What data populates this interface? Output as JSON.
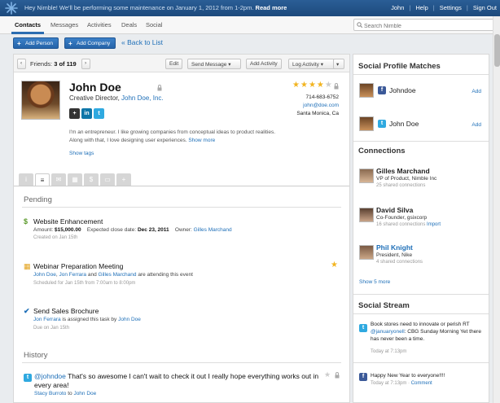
{
  "topbar": {
    "maintenance": "Hey Nimble! We'll be performing some maintenance on January 1, 2012 from 1-2pm.",
    "read_more": "Read more",
    "user": "John",
    "links": [
      "Help",
      "Settings",
      "Sign Out"
    ]
  },
  "nav": {
    "tabs": [
      "Contacts",
      "Messages",
      "Activities",
      "Deals",
      "Social"
    ],
    "active_tab": "Contacts",
    "search_placeholder": "Search Nimble"
  },
  "actions": {
    "add_person": "Add Person",
    "add_company": "Add Company",
    "back": "« Back to List"
  },
  "toolbar": {
    "friends_label": "Friends:",
    "friends_pos": "3 of 119",
    "edit": "Edit",
    "send_message": "Send Message",
    "add_activity": "Add Activity",
    "log_activity": "Log Activity"
  },
  "contact": {
    "name": "John Doe",
    "title": "Creative Director,",
    "company": "John Doe, Inc.",
    "phone": "714-683-6752",
    "email": "john@doe.com",
    "location": "Santa Monica, Ca",
    "rating": 4,
    "rating_max": 5,
    "bio": "I'm an entrepreneur. I like growing companies from conceptual ideas to product realities. Along with that, I love designing user experiences.",
    "show_more": "Show more",
    "show_tags": "Show tags",
    "social_icons": [
      "plus-icon",
      "linkedin-icon",
      "twitter-icon"
    ]
  },
  "pending": {
    "heading": "Pending",
    "items": [
      {
        "title": "Website Enhancement",
        "amount_label": "Amount:",
        "amount": "$15,000.00",
        "close_label": "Expected close date:",
        "close_date": "Dec 23, 2011",
        "owner_label": "Owner:",
        "owner": "Gilles Marchand",
        "created": "Created on Jan 15th"
      },
      {
        "title": "Webinar Preparation Meeting",
        "attendees_a": "John Doe",
        "attendees_b": "Jon Ferrara",
        "attendees_c": "Gilles Marchand",
        "attendees_suffix": "are attending this event",
        "scheduled": "Scheduled for Jan 15th from 7:00am to 8:00pm"
      },
      {
        "title": "Send Sales Brochure",
        "assignee": "Jon Ferrara",
        "assigned_text": "is assigned this task by",
        "assigner": "John Doe",
        "due": "Due on Jan 15th"
      }
    ]
  },
  "history": {
    "heading": "History",
    "handle": "@johndoe",
    "text": "That's so awesome I can't wait to check it out I really hope everything works out in every area!",
    "from": "Stacy Burroto",
    "to_label": "to",
    "to": "John Doe"
  },
  "social_matches": {
    "heading": "Social Profile Matches",
    "items": [
      {
        "network": "facebook",
        "handle": "Johndoe",
        "action": "Add"
      },
      {
        "network": "twitter",
        "handle": "John Doe",
        "action": "Add"
      }
    ]
  },
  "connections": {
    "heading": "Connections",
    "items": [
      {
        "name": "Gilles Marchand",
        "title": "VP of Product, Nimble Inc",
        "shared": "25 shared connections",
        "import": ""
      },
      {
        "name": "David Silva",
        "title": "Co-Founder, gsixcorp",
        "shared": "16 shared connections",
        "import": "Import"
      },
      {
        "name": "Phil Knight",
        "title": "President, Nike",
        "shared": "4 shared connections",
        "import": ""
      }
    ],
    "show_more": "Show 5 more"
  },
  "social_stream": {
    "heading": "Social Stream",
    "items": [
      {
        "network": "twitter",
        "text_a": "Book stores need to innovate or perish RT",
        "mention": "@januaryonell",
        "text_b": ": CBG Sunday Morning Yet there has never been a time.",
        "time": "Today at 7:13pm"
      },
      {
        "network": "facebook",
        "text": "Happy New Year to everyone!!!!",
        "time": "Today at 7:13pm",
        "sep": " · ",
        "comment": "Comment"
      }
    ]
  },
  "colors": {
    "topbar": "#1d4a7c",
    "accent": "#2563a8",
    "link": "#1e6fb8",
    "star": "#f2b420",
    "facebook": "#3b5998",
    "twitter": "#2fa9e0",
    "linkedin": "#0e76a8"
  }
}
